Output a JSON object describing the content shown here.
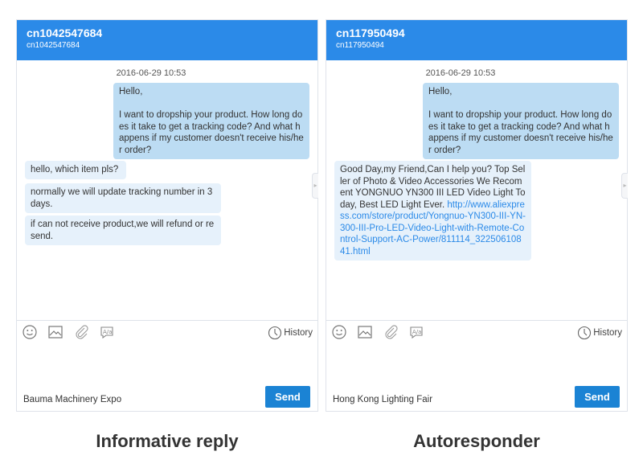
{
  "panels": [
    {
      "title": "cn1042547684",
      "subtitle": "cn1042547684",
      "timestamp": "2016-06-29 10:53",
      "messages": [
        {
          "dir": "out",
          "text": "Hello,\n\nI want to dropship your product. How long does it take to get a tracking code? And what happens if my customer doesn't receive his/her order?"
        },
        {
          "dir": "in",
          "text": "hello, which item pls?"
        },
        {
          "dir": "in",
          "text": "normally we will update tracking number in 3 days."
        },
        {
          "dir": "in",
          "text": "if can not receive product,we will refund or resend."
        }
      ],
      "history_label": "History",
      "footer_label": "Bauma Machinery Expo",
      "send_label": "Send",
      "caption": "Informative reply"
    },
    {
      "title": "cn117950494",
      "subtitle": "cn117950494",
      "timestamp": "2016-06-29 10:53",
      "messages": [
        {
          "dir": "out",
          "text": "Hello,\n\nI want to dropship your product. How long does it take to get a tracking code? And what happens if my customer doesn't receive his/her order?"
        },
        {
          "dir": "in",
          "text": "Good Day,my Friend,Can I help you? Top Seller of Photo & Video Accessories We Recoment YONGNUO YN300 III LED Video Light Today, Best LED Light Ever. ",
          "link": "http://www.aliexpress.com/store/product/Yongnuo-YN300-III-YN-300-III-Pro-LED-Video-Light-with-Remote-Control-Support-AC-Power/811114_32250610841.html"
        }
      ],
      "history_label": "History",
      "footer_label": "Hong Kong Lighting Fair",
      "send_label": "Send",
      "caption": "Autoresponder"
    }
  ],
  "colors": {
    "header": "#2b8ae8",
    "outgoing": "#bcdcf3",
    "incoming": "#e6f1fb",
    "send": "#1b83d4",
    "link": "#2b8ae8"
  },
  "icons": [
    "emoji-icon",
    "image-icon",
    "attachment-icon",
    "translate-icon",
    "clock-icon"
  ]
}
